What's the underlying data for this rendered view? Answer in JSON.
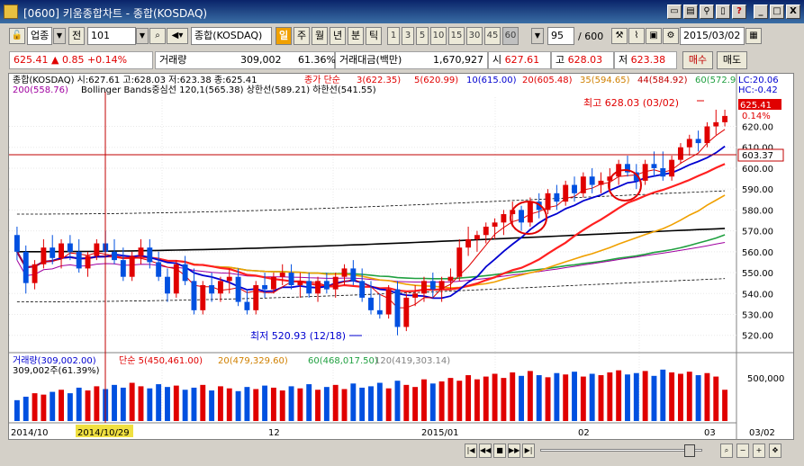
{
  "window": {
    "title": "[0600] 키움종합차트 - 종합(KOSDAQ)",
    "help_label": "?",
    "minimize_label": "_",
    "maximize_label": "□",
    "close_label": "X"
  },
  "toolbar": {
    "market": "업종",
    "all_label": "전",
    "code": "101",
    "name": "종합(KOSDAQ)",
    "period_tabs": [
      "일",
      "주",
      "월",
      "년",
      "분",
      "틱"
    ],
    "active_period": "일",
    "minute_options": [
      "1",
      "3",
      "5",
      "10",
      "15",
      "30",
      "45",
      "60"
    ],
    "selected_minute": "60",
    "count": "95",
    "total": "/ 600",
    "date": "2015/03/02"
  },
  "quote": {
    "price": "625.41",
    "arrow": "▲",
    "change": "0.85",
    "change_pct": "+0.14%",
    "volume_label": "거래량",
    "volume": "309,002",
    "volume_pct": "61.36%",
    "amount_label": "거래대금(백만)",
    "amount": "1,670,927",
    "open_label": "시",
    "open": "627.61",
    "high_label": "고",
    "high": "628.03",
    "low_label": "저",
    "low": "623.38",
    "buy_label": "매수",
    "sell_label": "매도"
  },
  "legend": {
    "price_line1": "종합(KOSDAQ) 시:627.61 고:628.03 저:623.38 종:625.41",
    "ma_label": "종가 단순",
    "ma3": "3(622.35)",
    "ma5": "5(620.99)",
    "ma10": "10(615.00)",
    "ma20": "20(605.48)",
    "ma35": "35(594.65)",
    "ma44": "44(584.92)",
    "ma60": "60(572.9",
    "ma200": "200(558.76)",
    "bollinger": "Bollinger Bands중심선 120,1(565.38)  상한선(589.21)  하한선(541.55)",
    "lc": "LC:20.06",
    "hc": "HC:-0.42"
  },
  "annotations": {
    "high_text": "최고 628.03 (03/02)",
    "low_text": "최저 520.93 (12/18)",
    "last_price_tag": "625.41",
    "last_pct_tag": "0.14%",
    "crosshair_price_tag": "603.37"
  },
  "volume_legend": {
    "label": "거래량(309,002.00)",
    "ma_label": "단순 5(450,461.00)",
    "ma20": "20(479,329.60)",
    "ma60": "60(468,017.50)",
    "ma120": "120(419,303.14)",
    "sub": "309,002주(61.39%)",
    "axis_tick": "500,000"
  },
  "xaxis": {
    "ticks": [
      "2014/10",
      "2014/10/29",
      "12",
      "2015/01",
      "02",
      "03"
    ],
    "right_label": "03/02"
  },
  "colors": {
    "up": "#e00000",
    "down": "#0050e0",
    "ma5": "#e00000",
    "ma10": "#0000d0",
    "ma20": "#ff2020",
    "ma35": "#f0a000",
    "ma60": "#20a040",
    "ma200": "#a000a0",
    "bollinger": "#000000"
  },
  "chart_data": {
    "type": "candlestick",
    "ylim": [
      516,
      634
    ],
    "yticks": [
      520,
      530,
      540,
      550,
      560,
      570,
      580,
      590,
      600,
      610,
      620
    ],
    "candles": [
      [
        568,
        572,
        556,
        560
      ],
      [
        560,
        563,
        540,
        545
      ],
      [
        545,
        556,
        542,
        554
      ],
      [
        554,
        566,
        552,
        562
      ],
      [
        562,
        568,
        554,
        557
      ],
      [
        557,
        566,
        552,
        564
      ],
      [
        564,
        568,
        556,
        560
      ],
      [
        560,
        566,
        550,
        552
      ],
      [
        552,
        560,
        548,
        558
      ],
      [
        558,
        566,
        556,
        564
      ],
      [
        564,
        570,
        558,
        560
      ],
      [
        560,
        566,
        554,
        556
      ],
      [
        556,
        562,
        546,
        548
      ],
      [
        548,
        560,
        546,
        558
      ],
      [
        558,
        566,
        554,
        562
      ],
      [
        562,
        566,
        552,
        555
      ],
      [
        555,
        560,
        546,
        548
      ],
      [
        548,
        552,
        536,
        540
      ],
      [
        540,
        556,
        538,
        554
      ],
      [
        554,
        558,
        544,
        546
      ],
      [
        546,
        552,
        530,
        532
      ],
      [
        532,
        546,
        530,
        544
      ],
      [
        544,
        550,
        536,
        540
      ],
      [
        540,
        548,
        536,
        546
      ],
      [
        546,
        552,
        540,
        548
      ],
      [
        548,
        552,
        534,
        536
      ],
      [
        536,
        542,
        530,
        532
      ],
      [
        532,
        546,
        530,
        544
      ],
      [
        544,
        550,
        538,
        542
      ],
      [
        542,
        550,
        540,
        548
      ],
      [
        548,
        554,
        544,
        550
      ],
      [
        550,
        554,
        542,
        544
      ],
      [
        544,
        550,
        538,
        546
      ],
      [
        546,
        550,
        538,
        540
      ],
      [
        540,
        548,
        536,
        546
      ],
      [
        546,
        550,
        540,
        542
      ],
      [
        542,
        550,
        538,
        548
      ],
      [
        548,
        554,
        544,
        552
      ],
      [
        552,
        556,
        544,
        546
      ],
      [
        546,
        552,
        536,
        538
      ],
      [
        538,
        546,
        530,
        532
      ],
      [
        532,
        540,
        528,
        530
      ],
      [
        530,
        544,
        528,
        542
      ],
      [
        542,
        546,
        520,
        524
      ],
      [
        524,
        540,
        522,
        538
      ],
      [
        538,
        544,
        534,
        540
      ],
      [
        540,
        548,
        536,
        546
      ],
      [
        546,
        550,
        538,
        542
      ],
      [
        542,
        548,
        536,
        546
      ],
      [
        546,
        552,
        542,
        548
      ],
      [
        548,
        566,
        546,
        562
      ],
      [
        562,
        572,
        558,
        566
      ],
      [
        566,
        570,
        560,
        568
      ],
      [
        568,
        574,
        564,
        572
      ],
      [
        572,
        576,
        566,
        574
      ],
      [
        574,
        580,
        568,
        578
      ],
      [
        578,
        584,
        572,
        580
      ],
      [
        580,
        582,
        570,
        574
      ],
      [
        574,
        586,
        572,
        584
      ],
      [
        584,
        588,
        576,
        580
      ],
      [
        580,
        590,
        578,
        588
      ],
      [
        588,
        592,
        580,
        584
      ],
      [
        584,
        594,
        582,
        592
      ],
      [
        592,
        596,
        584,
        588
      ],
      [
        588,
        598,
        586,
        596
      ],
      [
        596,
        600,
        588,
        592
      ],
      [
        592,
        598,
        588,
        594
      ],
      [
        594,
        600,
        590,
        596
      ],
      [
        596,
        604,
        592,
        602
      ],
      [
        602,
        606,
        596,
        598
      ],
      [
        598,
        602,
        590,
        594
      ],
      [
        594,
        604,
        592,
        602
      ],
      [
        602,
        608,
        596,
        600
      ],
      [
        600,
        608,
        594,
        596
      ],
      [
        596,
        606,
        594,
        604
      ],
      [
        604,
        612,
        602,
        610
      ],
      [
        610,
        616,
        606,
        614
      ],
      [
        614,
        618,
        608,
        612
      ],
      [
        612,
        622,
        610,
        620
      ],
      [
        620,
        628,
        616,
        622
      ],
      [
        622,
        628,
        620,
        625
      ]
    ],
    "volumes": [
      30,
      35,
      40,
      38,
      42,
      45,
      40,
      48,
      44,
      50,
      46,
      52,
      48,
      55,
      50,
      47,
      53,
      49,
      51,
      45,
      48,
      52,
      44,
      50,
      47,
      43,
      49,
      46,
      51,
      48,
      44,
      50,
      47,
      53,
      45,
      49,
      52,
      46,
      54,
      48,
      50,
      55,
      47,
      58,
      52,
      49,
      60,
      54,
      57,
      62,
      58,
      66,
      60,
      64,
      68,
      62,
      70,
      65,
      72,
      66,
      63,
      69,
      67,
      71,
      64,
      68,
      66,
      70,
      73,
      67,
      69,
      72,
      65,
      74,
      70,
      68,
      71,
      66,
      69,
      64,
      45
    ]
  }
}
